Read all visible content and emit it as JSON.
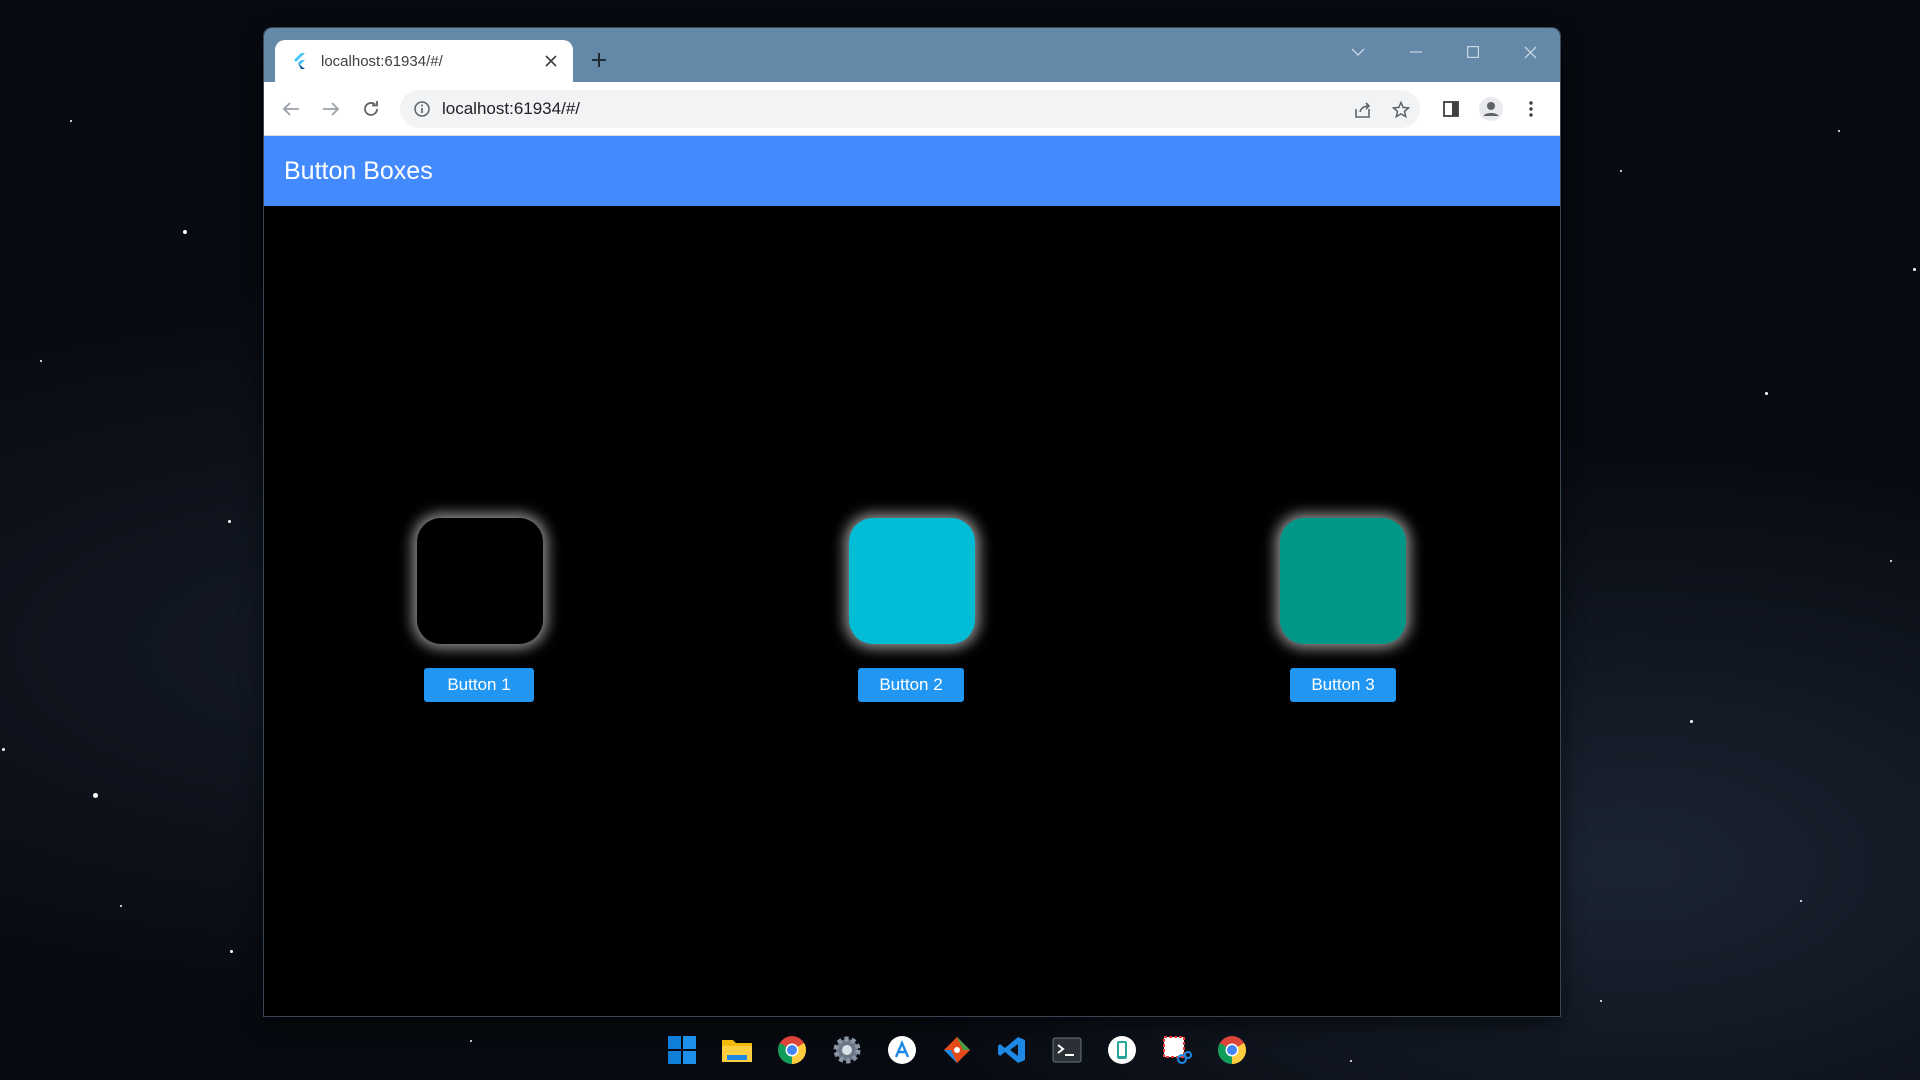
{
  "browser": {
    "tab_title": "localhost:61934/#/",
    "url": "localhost:61934/#/"
  },
  "app": {
    "title": "Button Boxes",
    "boxes": [
      {
        "color": "#000000"
      },
      {
        "color": "#00bcd4"
      },
      {
        "color": "#009688"
      }
    ],
    "buttons": [
      {
        "label": "Button 1"
      },
      {
        "label": "Button 2"
      },
      {
        "label": "Button 3"
      }
    ]
  },
  "taskbar": {
    "icons": [
      "windows-start-icon",
      "file-explorer-icon",
      "chrome-icon",
      "settings-icon",
      "app-store-icon",
      "git-icon",
      "vscode-icon",
      "terminal-icon",
      "phone-link-icon",
      "snipping-tool-icon",
      "chrome-icon"
    ]
  },
  "colors": {
    "appbar": "#448aff",
    "button": "#2196f3",
    "tabbar": "#6489a8"
  }
}
